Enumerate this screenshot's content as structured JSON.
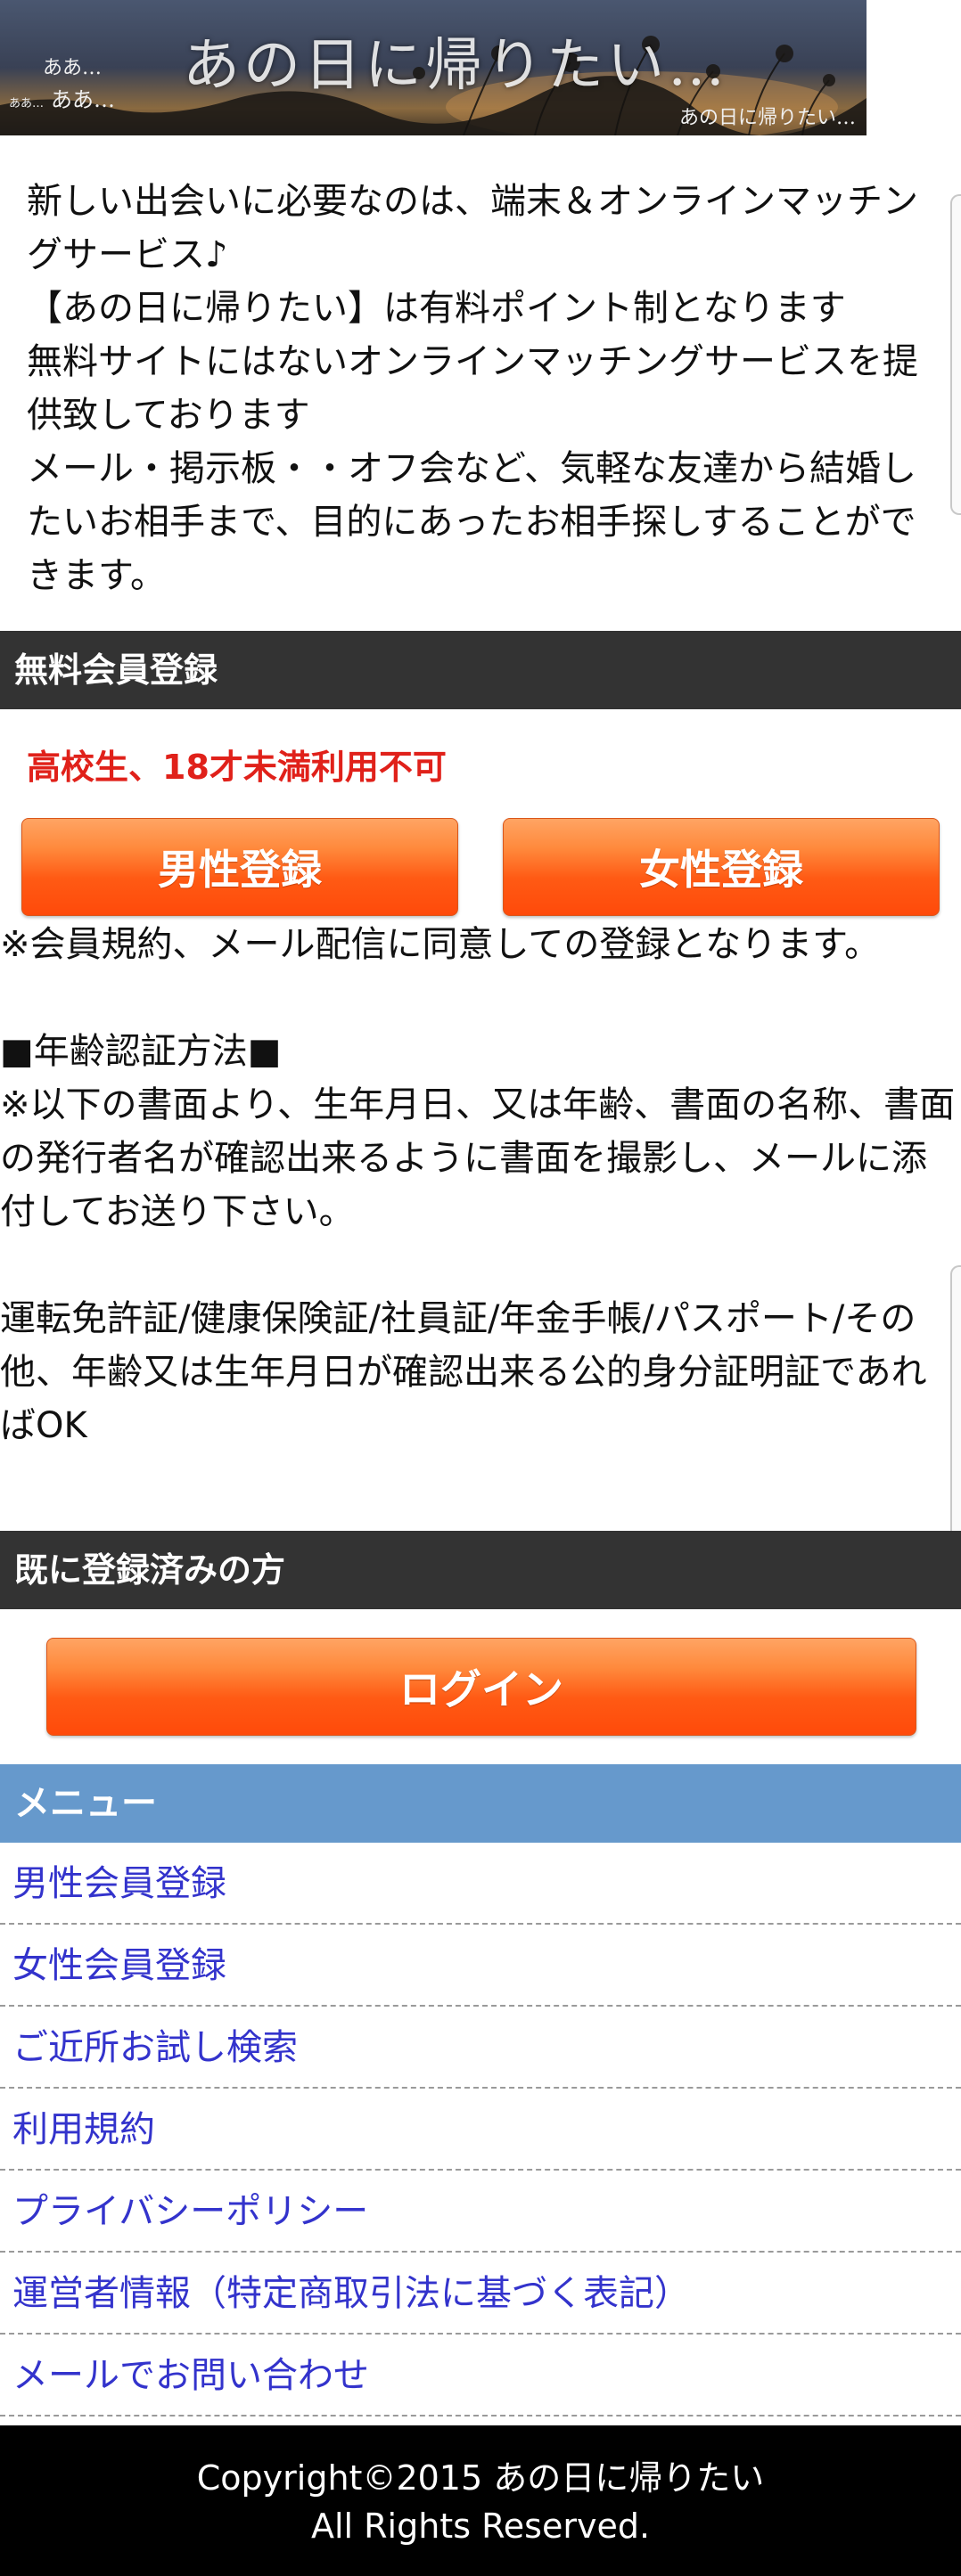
{
  "banner": {
    "title": "あの日に帰りたい…",
    "sub_a": "ああ…",
    "sub_b_small": "ああ…",
    "sub_b": "ああ…",
    "tagline": "あの日に帰りたい…"
  },
  "intro": {
    "lines": [
      "新しい出会いに必要なのは、端末＆オンラインマッチングサービス♪",
      "【あの日に帰りたい】は有料ポイント制となります",
      "無料サイトにはないオンラインマッチングサービスを提供致しております",
      "メール・掲示板・・オフ会など、気軽な友達から結婚したいお相手まで、目的にあったお相手探しすることができます。"
    ]
  },
  "registration": {
    "header": "無料会員登録",
    "warning": "高校生、18才未満利用不可",
    "male_button": "男性登録",
    "female_button": "女性登録",
    "agreement_note": "※会員規約、メール配信に同意しての登録となります。",
    "age_title": "■年齢認証方法■",
    "age_instructions": "※以下の書面より、生年月日、又は年齢、書面の名称、書面の発行者名が確認出来るように書面を撮影し、メールに添付してお送り下さい。",
    "id_documents": "運転免許証/健康保険証/社員証/年金手帳/パスポート/その他、年齢又は生年月日が確認出来る公的身分証明証であればOK"
  },
  "login": {
    "header": "既に登録済みの方",
    "button": "ログイン"
  },
  "menu": {
    "header": "メニュー",
    "items": [
      "男性会員登録",
      "女性会員登録",
      "ご近所お試し検索",
      "利用規約",
      "プライバシーポリシー",
      "運営者情報（特定商取引法に基づく表記）",
      "メールでお問い合わせ"
    ]
  },
  "footer": {
    "copyright": "Copyright©2015 あの日に帰りたい",
    "rights": "All Rights Reserved."
  },
  "colors": {
    "section_header": "#333333",
    "menu_header": "#6699cc",
    "warning_red": "#e0211a",
    "link_blue": "#3333cc",
    "button_orange": "#ff5a14"
  }
}
